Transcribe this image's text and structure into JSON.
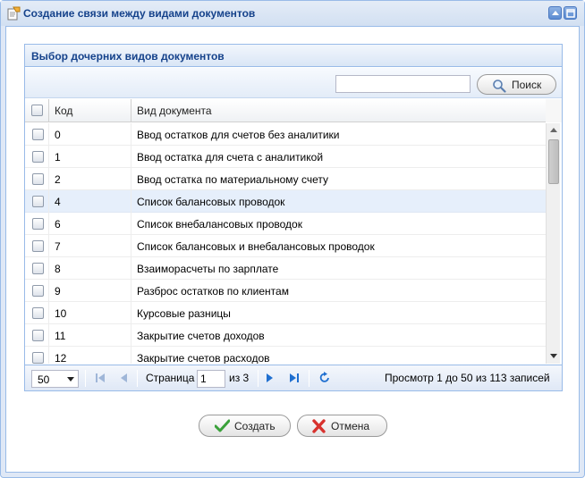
{
  "window": {
    "title": "Создание связи между видами документов"
  },
  "panel": {
    "title": "Выбор дочерних видов документов"
  },
  "search": {
    "value": "",
    "placeholder": "",
    "button_label": "Поиск"
  },
  "grid": {
    "columns": [
      "Код",
      "Вид документа"
    ],
    "rows": [
      {
        "code": "0",
        "name": "Ввод остатков для счетов без аналитики",
        "checked": false,
        "selected": false
      },
      {
        "code": "1",
        "name": "Ввод остатка для счета с аналитикой",
        "checked": false,
        "selected": false
      },
      {
        "code": "2",
        "name": "Ввод остатка по материальному счету",
        "checked": false,
        "selected": false
      },
      {
        "code": "4",
        "name": "Список балансовых проводок",
        "checked": false,
        "selected": true
      },
      {
        "code": "6",
        "name": "Список внебалансовых проводок",
        "checked": false,
        "selected": false
      },
      {
        "code": "7",
        "name": "Список балансовых и внебалансовых проводок",
        "checked": false,
        "selected": false
      },
      {
        "code": "8",
        "name": "Взаиморасчеты по зарплате",
        "checked": false,
        "selected": false
      },
      {
        "code": "9",
        "name": "Разброс остатков по клиентам",
        "checked": false,
        "selected": false
      },
      {
        "code": "10",
        "name": "Курсовые разницы",
        "checked": false,
        "selected": false
      },
      {
        "code": "11",
        "name": "Закрытие счетов доходов",
        "checked": false,
        "selected": false
      },
      {
        "code": "12",
        "name": "Закрытие счетов расходов",
        "checked": false,
        "selected": false
      }
    ]
  },
  "pager": {
    "page_size": "50",
    "page_label": "Страница",
    "current_page": "1",
    "of_pages": "из 3",
    "display_info": "Просмотр 1 до 50 из 113 записей"
  },
  "actions": {
    "create_label": "Создать",
    "cancel_label": "Отмена"
  },
  "colors": {
    "accent": "#15428b",
    "border": "#99bbe8",
    "selected_row": "#e6effb",
    "create_icon": "#3aa13a",
    "cancel_icon": "#d8322e"
  },
  "icons": {
    "title": "document-link-icon",
    "minimize": "minimize-icon",
    "maximize": "maximize-icon",
    "search": "magnifier-icon",
    "first": "first-page-icon",
    "prev": "prev-page-icon",
    "next": "next-page-icon",
    "last": "last-page-icon",
    "refresh": "refresh-icon",
    "create": "checkmark-icon",
    "cancel": "cross-icon"
  }
}
